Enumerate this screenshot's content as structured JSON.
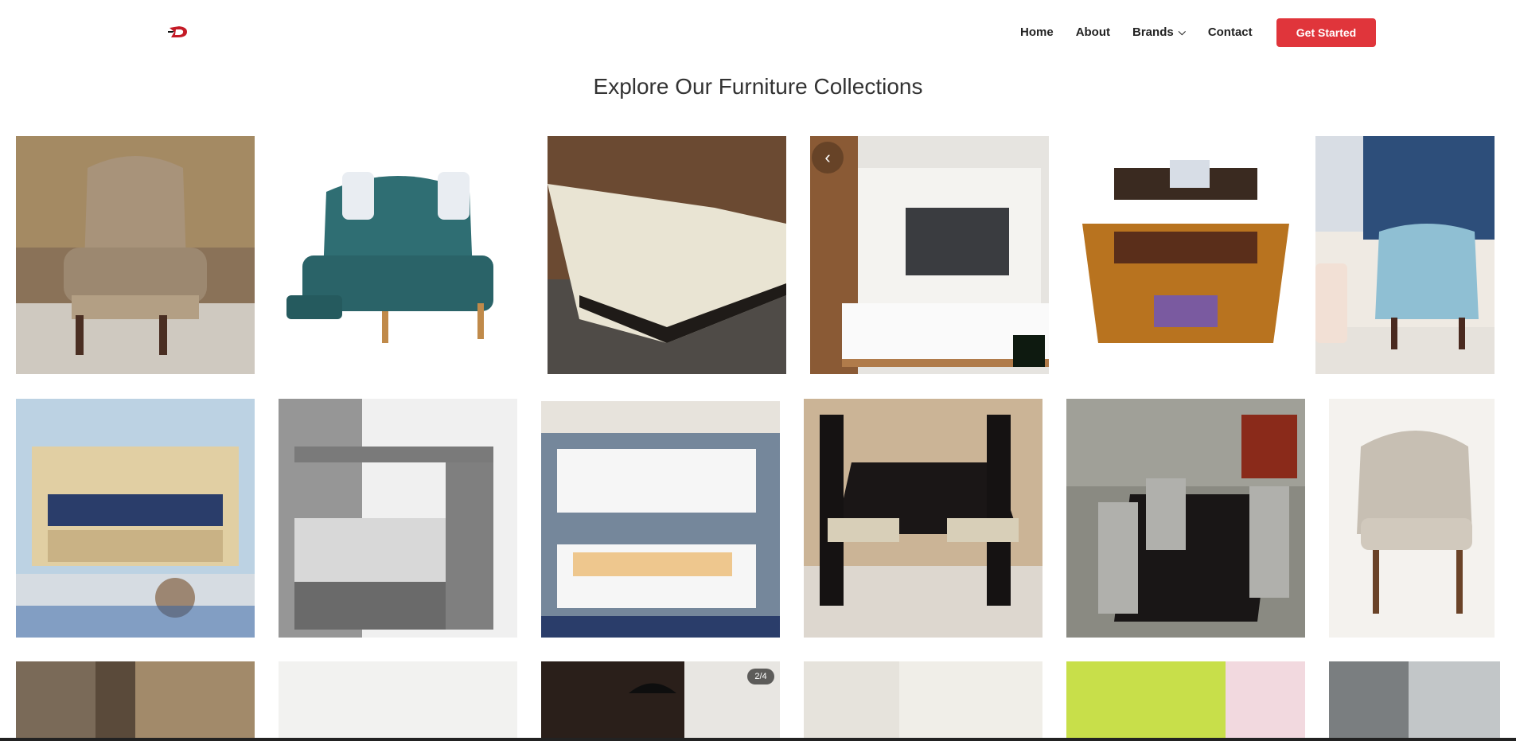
{
  "logo": {
    "alt": "D"
  },
  "nav": {
    "links": [
      {
        "label": "Home"
      },
      {
        "label": "About"
      },
      {
        "label": "Brands",
        "has_dropdown": true
      },
      {
        "label": "Contact"
      }
    ],
    "cta": "Get Started"
  },
  "colors": {
    "accent": "#e0353b"
  },
  "page_title": "Explore Our Furniture Collections",
  "gallery": {
    "counter": "2/4",
    "row1": [
      "tufted-wingback-armchair",
      "teal-recliner-loveseat",
      "cream-leather-sectional",
      "tv-wall-unit",
      "wooden-studio-desk",
      "blue-accent-chair"
    ],
    "row2": [
      "kids-wooden-bed",
      "grey-loft-bunk-bed",
      "white-bunk-bed",
      "dark-dining-set",
      "grey-dining-set",
      "beige-lounge-chair"
    ],
    "row3": [
      "living-room-interior",
      "white-room",
      "pendant-lamp-room",
      "marble-room",
      "green-wall-room",
      "grey-window-room"
    ]
  }
}
